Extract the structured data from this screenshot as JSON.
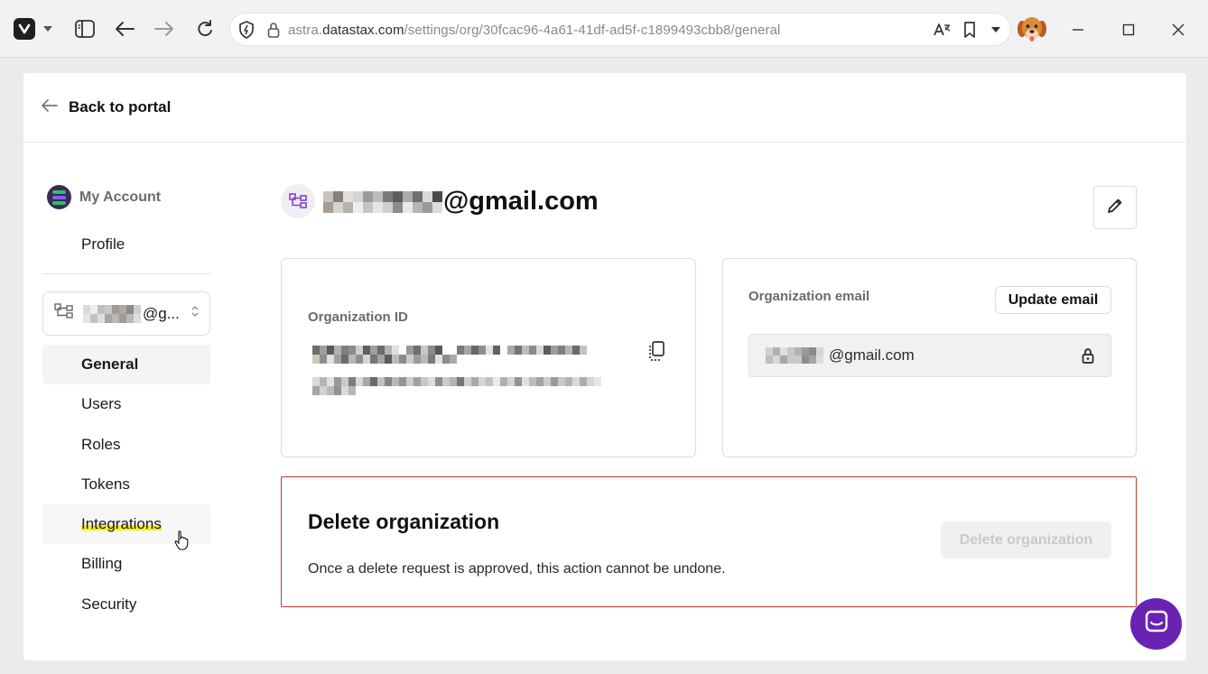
{
  "browser": {
    "url_prefix": "astra.",
    "url_domain": "datastax.com",
    "url_path": "/settings/org/30fcac96-4a61-41df-ad5f-c1899493cbb8/general",
    "icons": [
      "vivaldi-logo",
      "panel-toggle-icon",
      "back-arrow-icon",
      "forward-arrow-icon",
      "reload-icon",
      "shield-icon",
      "lock-icon",
      "translate-icon",
      "bookmark-icon",
      "dropdown-icon",
      "minimize-icon",
      "maximize-icon",
      "close-icon"
    ]
  },
  "header": {
    "back_label": "Back to portal"
  },
  "sidebar": {
    "account_label": "My Account",
    "profile_label": "Profile",
    "org_select_suffix": "@g...",
    "items": [
      {
        "label": "General",
        "active": true
      },
      {
        "label": "Users"
      },
      {
        "label": "Roles"
      },
      {
        "label": "Tokens"
      },
      {
        "label": "Integrations",
        "highlighted": true
      },
      {
        "label": "Billing"
      },
      {
        "label": "Security"
      }
    ]
  },
  "org": {
    "title_suffix": "@gmail.com"
  },
  "id_panel": {
    "label": "Organization ID"
  },
  "email_panel": {
    "label": "Organization email",
    "update_label": "Update email",
    "value_suffix": "@gmail.com"
  },
  "danger": {
    "title": "Delete organization",
    "description": "Once a delete request is approved, this action cannot be undone.",
    "button_label": "Delete organization"
  },
  "colors": {
    "accent": "#6a22b3",
    "danger_border": "#c0392b",
    "highlight": "#f7ef1a"
  }
}
